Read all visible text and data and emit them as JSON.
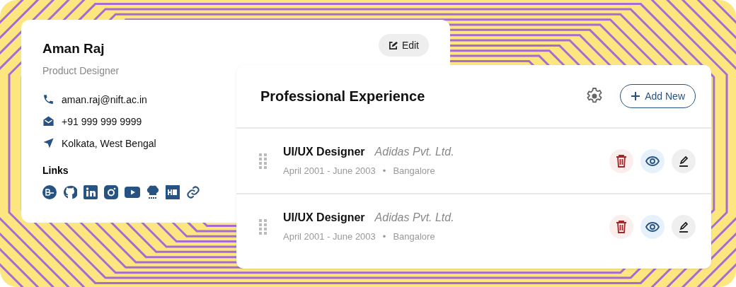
{
  "profile": {
    "name": "Aman Raj",
    "role": "Product Designer",
    "edit_button": "Edit",
    "contacts": [
      {
        "kind": "phone",
        "text": "aman.raj@nift.ac.in"
      },
      {
        "kind": "mail",
        "text": "+91 999 999 9999"
      },
      {
        "kind": "location",
        "text": "Kolkata, West Bengal"
      }
    ],
    "links_heading": "Links"
  },
  "experience": {
    "title": "Professional Experience",
    "add_button": "Add New",
    "items": [
      {
        "role": "UI/UX Designer",
        "company": "Adidas Pvt. Ltd.",
        "dates": "April 2001 - June 2003",
        "separator": "•",
        "location": "Bangalore"
      },
      {
        "role": "UI/UX Designer",
        "company": "Adidas Pvt. Ltd.",
        "dates": "April 2001 - June 2003",
        "separator": "•",
        "location": "Bangalore"
      }
    ]
  }
}
